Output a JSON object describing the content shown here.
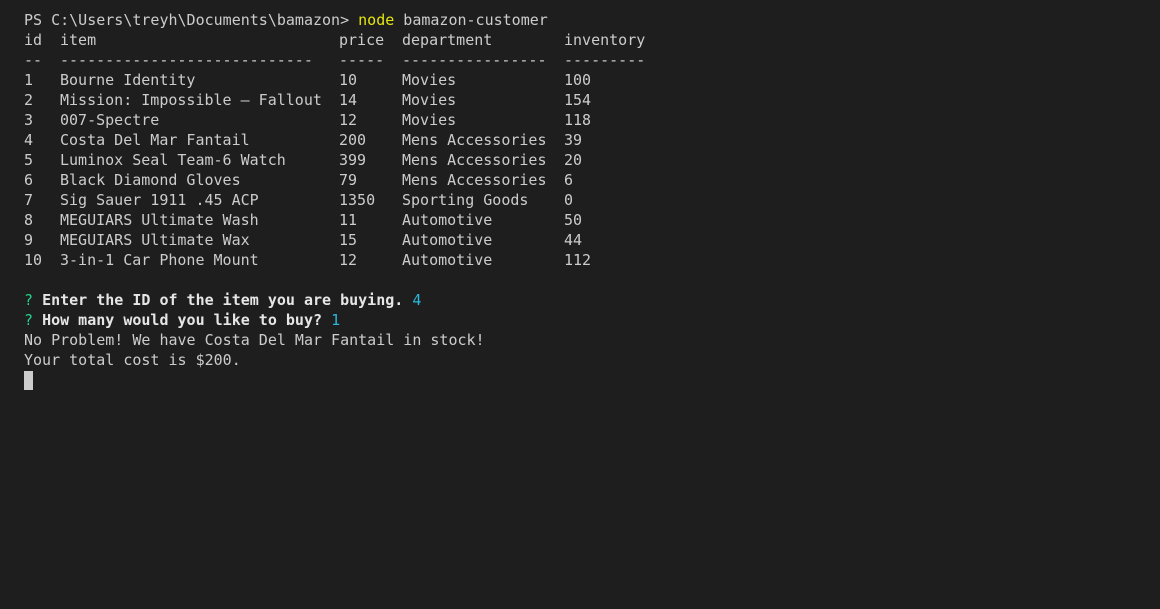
{
  "prompt": {
    "path": "PS C:\\Users\\treyh\\Documents\\bamazon>",
    "command": "node",
    "args": "bamazon-customer"
  },
  "table": {
    "headers": [
      "id",
      "item",
      "price",
      "department",
      "inventory"
    ],
    "separators": [
      "--",
      "----------------------------",
      "-----",
      "----------------",
      "---------"
    ],
    "rows": [
      [
        "1",
        "Bourne Identity",
        "10",
        "Movies",
        "100"
      ],
      [
        "2",
        "Mission: Impossible – Fallout",
        "14",
        "Movies",
        "154"
      ],
      [
        "3",
        "007-Spectre",
        "12",
        "Movies",
        "118"
      ],
      [
        "4",
        "Costa Del Mar Fantail",
        "200",
        "Mens Accessories",
        "39"
      ],
      [
        "5",
        "Luminox Seal Team-6 Watch",
        "399",
        "Mens Accessories",
        "20"
      ],
      [
        "6",
        "Black Diamond Gloves",
        "79",
        "Mens Accessories",
        "6"
      ],
      [
        "7",
        "Sig Sauer 1911 .45 ACP",
        "1350",
        "Sporting Goods",
        "0"
      ],
      [
        "8",
        "MEGUIARS Ultimate Wash",
        "11",
        "Automotive",
        "50"
      ],
      [
        "9",
        "MEGUIARS Ultimate Wax",
        "15",
        "Automotive",
        "44"
      ],
      [
        "10",
        "3-in-1 Car Phone Mount",
        "12",
        "Automotive",
        "112"
      ]
    ]
  },
  "questions": [
    {
      "mark": "?",
      "text": "Enter the ID of the item you are buying.",
      "answer": "4"
    },
    {
      "mark": "?",
      "text": "How many would you like to buy?",
      "answer": "1"
    }
  ],
  "output": [
    "No Problem! We have Costa Del Mar Fantail in stock!",
    "Your total cost is $200."
  ],
  "colors": {
    "background": "#1e1e1e",
    "text": "#cccccc",
    "command": "#e5e510",
    "question_mark": "#23d18b",
    "answer": "#29b8db"
  }
}
